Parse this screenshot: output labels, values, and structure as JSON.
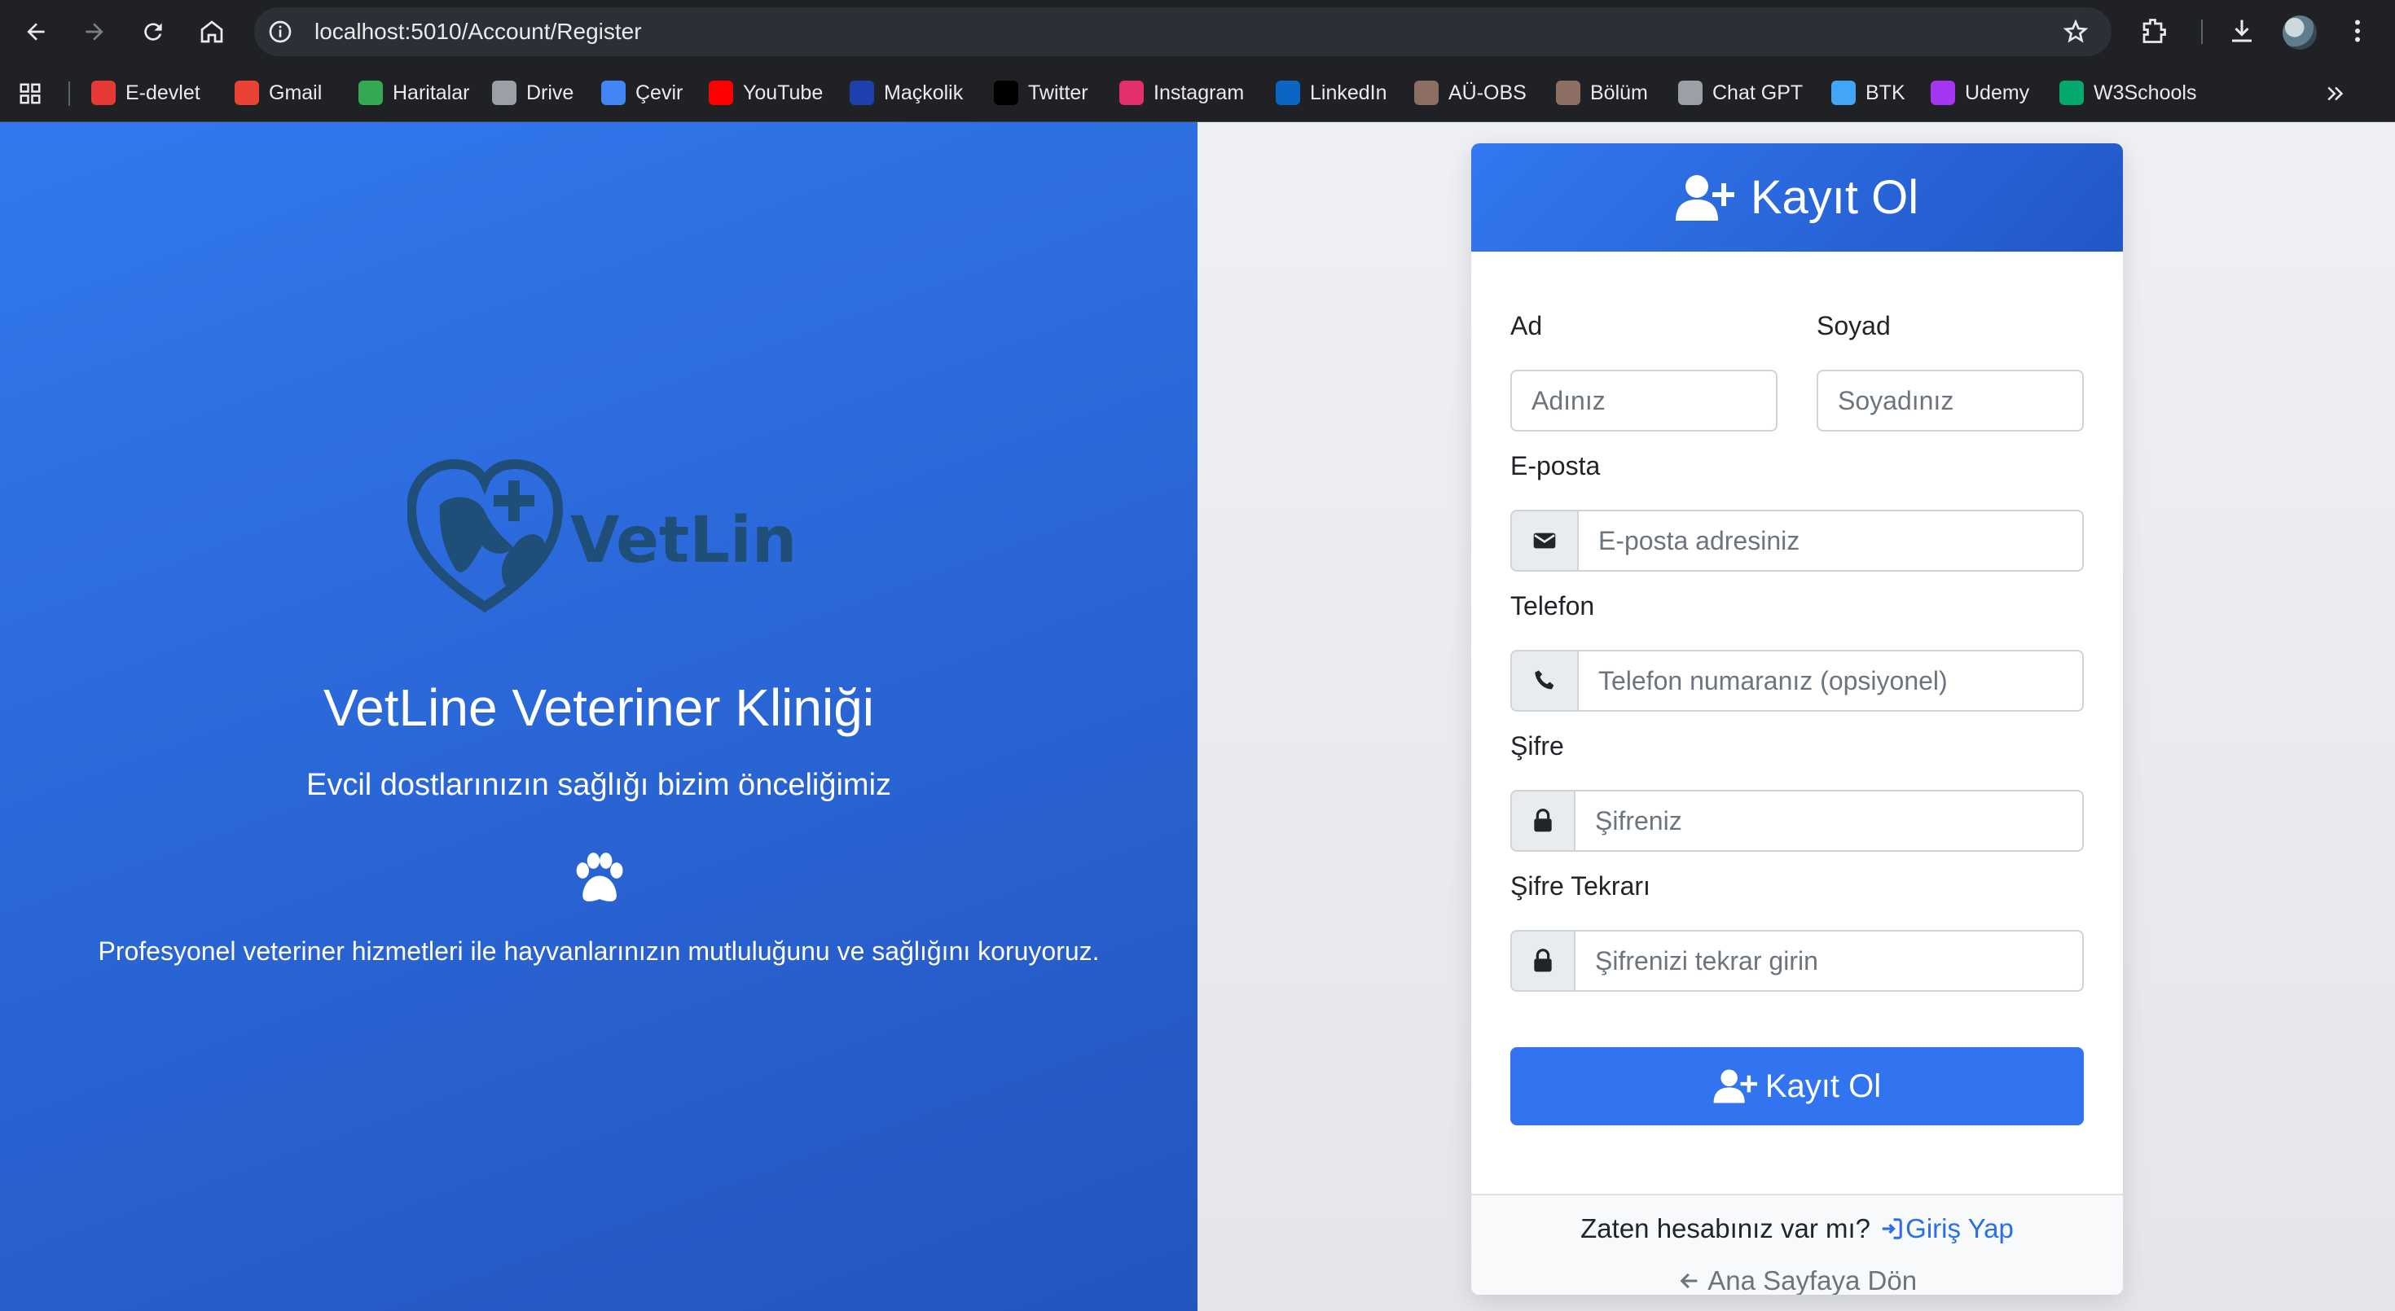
{
  "browser": {
    "url": "localhost:5010/Account/Register",
    "bookmarks": [
      {
        "label": "E-devlet",
        "icon": "edevlet-icon",
        "color": "#e53935"
      },
      {
        "label": "Gmail",
        "icon": "gmail-icon",
        "color": "#ea4335"
      },
      {
        "label": "Haritalar",
        "icon": "maps-icon",
        "color": "#34a853"
      },
      {
        "label": "Drive",
        "icon": "drive-icon",
        "color": "#9aa0a6"
      },
      {
        "label": "Çevir",
        "icon": "translate-icon",
        "color": "#4285f4"
      },
      {
        "label": "YouTube",
        "icon": "youtube-icon",
        "color": "#ff0000"
      },
      {
        "label": "Maçkolik",
        "icon": "mackolik-icon",
        "color": "#1e40af"
      },
      {
        "label": "Twitter",
        "icon": "x-icon",
        "color": "#000000"
      },
      {
        "label": "Instagram",
        "icon": "instagram-icon",
        "color": "#e1306c"
      },
      {
        "label": "LinkedIn",
        "icon": "linkedin-icon",
        "color": "#0a66c2"
      },
      {
        "label": "AÜ-OBS",
        "icon": "au-icon",
        "color": "#8d6e63"
      },
      {
        "label": "Bölüm",
        "icon": "bolum-icon",
        "color": "#8d6e63"
      },
      {
        "label": "Chat GPT",
        "icon": "chatgpt-icon",
        "color": "#9aa0a6"
      },
      {
        "label": "BTK",
        "icon": "btk-icon",
        "color": "#42a5f5"
      },
      {
        "label": "Udemy",
        "icon": "udemy-icon",
        "color": "#a435f0"
      },
      {
        "label": "W3Schools",
        "icon": "w3schools-icon",
        "color": "#04aa6d"
      }
    ]
  },
  "hero": {
    "logo_text": "VetLine",
    "title": "VetLine Veteriner Kliniği",
    "subtitle": "Evcil dostlarınızın sağlığı bizim önceliğimiz",
    "description": "Profesyonel veteriner hizmetleri ile hayvanlarınızın mutluluğunu ve sağlığını koruyoruz."
  },
  "form": {
    "header": "Kayıt Ol",
    "first_name": {
      "label": "Ad",
      "placeholder": "Adınız"
    },
    "last_name": {
      "label": "Soyad",
      "placeholder": "Soyadınız"
    },
    "email": {
      "label": "E-posta",
      "placeholder": "E-posta adresiniz"
    },
    "phone": {
      "label": "Telefon",
      "placeholder": "Telefon numaranız (opsiyonel)"
    },
    "password": {
      "label": "Şifre",
      "placeholder": "Şifreniz"
    },
    "password_confirm": {
      "label": "Şifre Tekrarı",
      "placeholder": "Şifrenizi tekrar girin"
    },
    "submit": "Kayıt Ol",
    "footer": {
      "have_account": "Zaten hesabınız var mı?",
      "login_link": "Giriş Yap",
      "home_link": "Ana Sayfaya Dön"
    }
  },
  "colors": {
    "primary": "#3273f0",
    "link": "#2a6ee8",
    "logo_dark": "#1f4e79"
  }
}
